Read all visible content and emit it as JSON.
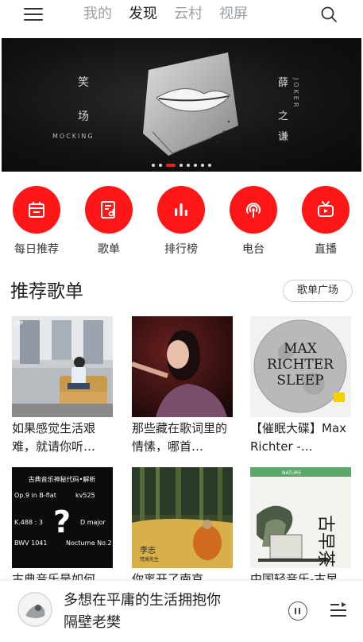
{
  "nav": {
    "tabs": [
      "我的",
      "发现",
      "云村",
      "视屏"
    ],
    "active_tab": 1
  },
  "banner": {
    "left_text_1": "笑",
    "left_text_2": "场",
    "left_caption": "MOCKING",
    "right_text_1": "薛",
    "right_text_2": "之",
    "right_text_3": "谦",
    "right_vertical": "JOKER",
    "dots_count": 8,
    "active_dot": 2
  },
  "entries": [
    {
      "label": "每日推荐",
      "icon": "calendar-icon"
    },
    {
      "label": "歌单",
      "icon": "playlist-icon"
    },
    {
      "label": "排行榜",
      "icon": "chart-icon"
    },
    {
      "label": "电台",
      "icon": "radio-icon"
    },
    {
      "label": "直播",
      "icon": "tv-icon"
    }
  ],
  "section": {
    "title": "推荐歌单",
    "more_button": "歌单广场"
  },
  "playlists": [
    {
      "title": "如果感觉生活艰难，就请你听…",
      "vip_badge": "VIP"
    },
    {
      "title": "那些藏在歌词里的情愫，哪首…"
    },
    {
      "title": "【催眠大碟】Max Richter -…",
      "cover_text": [
        "MAX",
        "RICHTER",
        "SLEEP"
      ]
    },
    {
      "title": "古典音乐是如何…",
      "cover_header": "古典音乐神秘代码•解析",
      "cover_codes": [
        "Op.9 in B-flat",
        "kv525",
        "K.488 : 3",
        "D major",
        "BWV 1041",
        "Nocturne No.2"
      ]
    },
    {
      "title": "你离开了南京…",
      "cover_text": [
        "李志",
        "梵高先生"
      ]
    },
    {
      "title": "中国轻音乐-古早…",
      "cover_text": [
        "古早茶",
        "NATURE"
      ]
    }
  ],
  "player": {
    "title": "多想在平庸的生活拥抱你",
    "artist": "隔壁老樊"
  },
  "colors": {
    "accent": "#ff1616",
    "text": "#222222",
    "muted": "#9aa0a6"
  }
}
